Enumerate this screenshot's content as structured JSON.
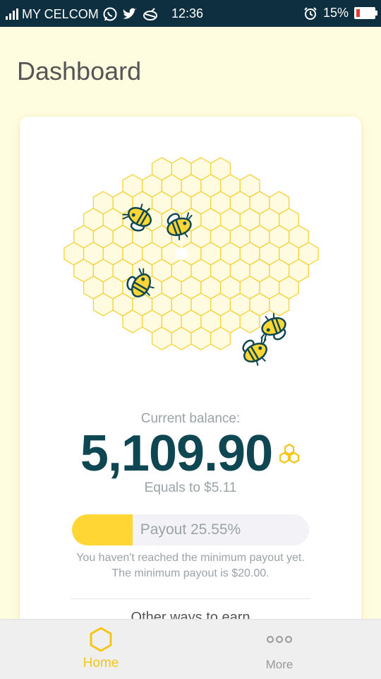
{
  "status_bar": {
    "carrier": "MY CELCOM",
    "time": "12:36",
    "battery": "15%",
    "icons": [
      "signal-icon",
      "whatsapp-icon",
      "twitter-icon",
      "bird-app-icon",
      "alarm-icon",
      "battery-icon"
    ]
  },
  "page": {
    "title": "Dashboard"
  },
  "balance": {
    "label": "Current balance:",
    "value": "5,109.90",
    "equals": "Equals to $5.11",
    "icon": "honeycomb-icon"
  },
  "payout": {
    "percent": 25.55,
    "text": "Payout 25.55%",
    "notice": "You haven't reached the minimum payout yet. The minimum payout is $20.00."
  },
  "other_tasks": {
    "heading": "Other ways to earn"
  },
  "nav": {
    "home_label": "Home",
    "more_label": "More",
    "home_icon": "hexagon-icon",
    "more_icon": "more-dots-icon"
  },
  "colors": {
    "status_bar": "#0d2f3f",
    "background": "#fffde0",
    "accent": "#f5c518",
    "balance_text": "#0e4752",
    "payout_fill": "#ffd633"
  }
}
